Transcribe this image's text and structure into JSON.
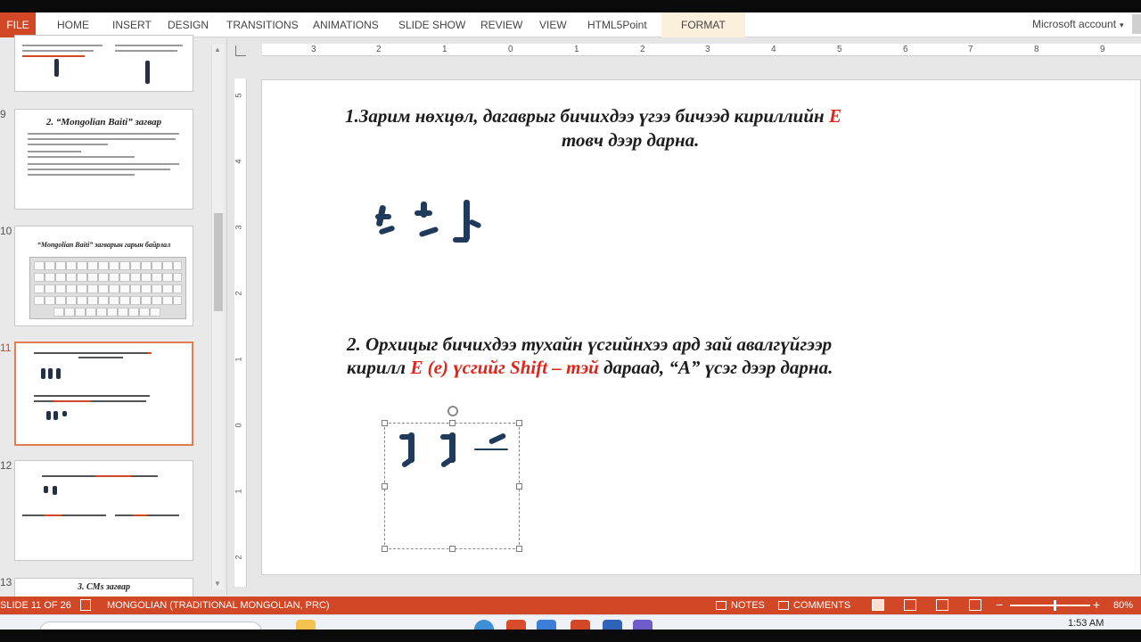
{
  "ribbon": {
    "file": "FILE",
    "tabs": [
      "HOME",
      "INSERT",
      "DESIGN",
      "TRANSITIONS",
      "ANIMATIONS",
      "SLIDE SHOW",
      "REVIEW",
      "VIEW",
      "HTML5Point"
    ],
    "format_tab": "FORMAT",
    "account": "Microsoft account",
    "account_arrow": "▾"
  },
  "thumbnails": {
    "slide9": {
      "number": "9",
      "title": "2. “Mongolian Baiti” загвар"
    },
    "slide10": {
      "number": "10",
      "title": "“Mongolian Baiti” загварын гарын байрлал"
    },
    "slide11": {
      "number": "11"
    },
    "slide12": {
      "number": "12"
    },
    "slide13": {
      "number": "13",
      "title": "3. CMs загвар"
    }
  },
  "ruler": {
    "h_labels": [
      "3",
      "2",
      "1",
      "0",
      "1",
      "2",
      "3",
      "4",
      "5",
      "6",
      "7",
      "8",
      "9"
    ],
    "v_labels": [
      "5",
      "4",
      "3",
      "2",
      "1",
      "0",
      "1",
      "2"
    ]
  },
  "slide": {
    "heading1_main": "1.Зарим нөхцөл, дагаврыг  бичихдээ үгээ бичээд кириллийн ",
    "heading1_red": "Е",
    "heading1_line2": "товч дээр дарна.",
    "heading2_line1": "2. Орхицыг бичихдээ тухайн үсгийнхээ ард зай авалгүйгээр",
    "heading2_line2_prefix": "кирилл ",
    "heading2_red": "Е (е) үсгийг Shift – тэй",
    "heading2_line2_suffix": " дараад, “А” үсэг дээр дарна."
  },
  "status": {
    "slide_of": "SLIDE 11 OF 26",
    "language": "MONGOLIAN (TRADITIONAL MONGOLIAN, PRC)",
    "notes": "NOTES",
    "comments": "COMMENTS",
    "zoom_minus": "−",
    "zoom_plus": "+",
    "zoom": "80%",
    "zoom_level_fraction": 0.55
  },
  "taskbar": {
    "time": "1:53 AM"
  }
}
